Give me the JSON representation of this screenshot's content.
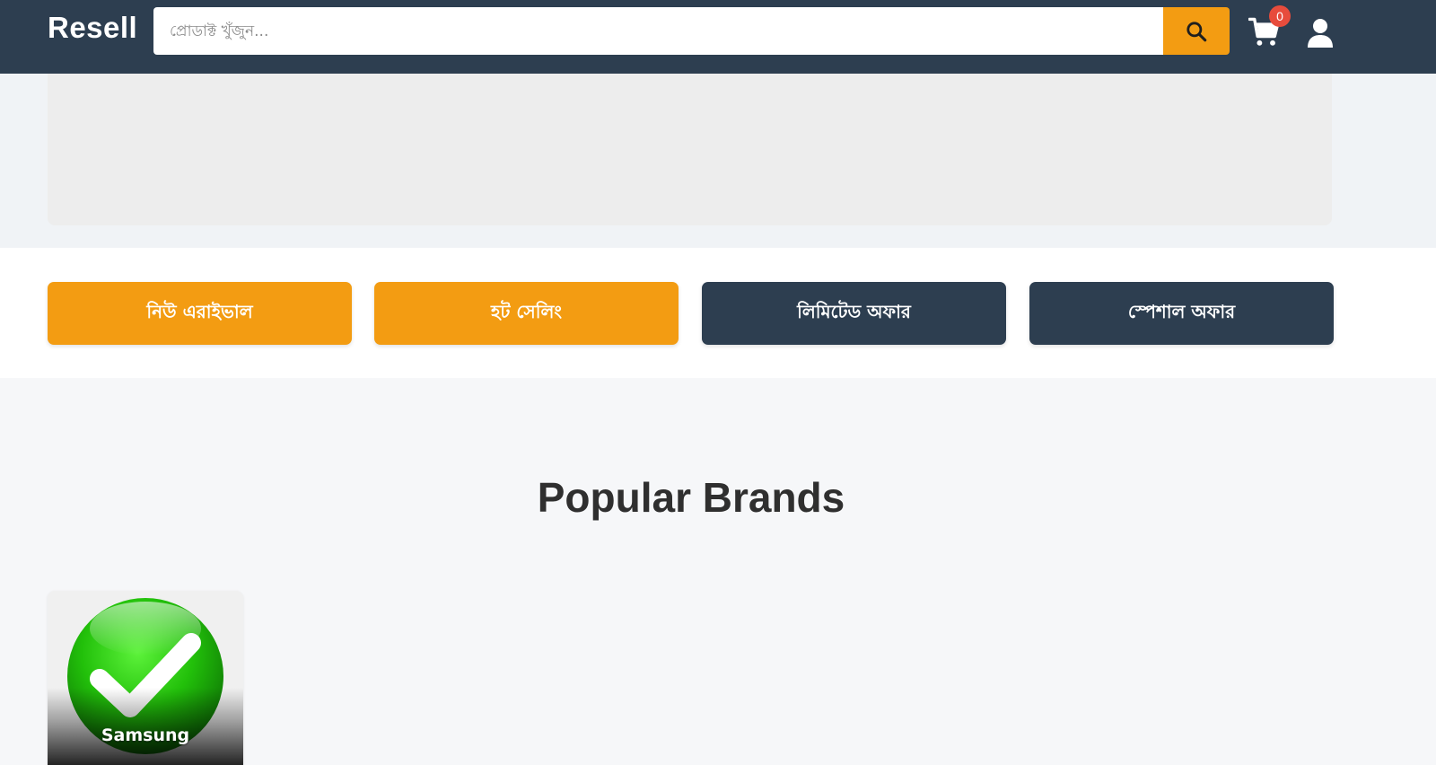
{
  "header": {
    "logo": "Resell",
    "search_placeholder": "প্রোডাক্ট খুঁজুন...",
    "search_value": "",
    "cart_count": "0"
  },
  "tabs": [
    {
      "label": "নিউ এরাইভাল",
      "color": "#f39c12"
    },
    {
      "label": "হট সেলিং",
      "color": "#f39c12"
    },
    {
      "label": "লিমিটেড অফার",
      "color": "#2d3e50"
    },
    {
      "label": "স্পেশাল অফার",
      "color": "#2d3e50"
    }
  ],
  "brands_section": {
    "title": "Popular Brands",
    "brands": [
      {
        "name": "Samsung",
        "icon": "green-check-icon"
      }
    ]
  },
  "colors": {
    "header_bg": "#2d3e50",
    "accent": "#f39c12",
    "badge": "#e74c3c"
  }
}
